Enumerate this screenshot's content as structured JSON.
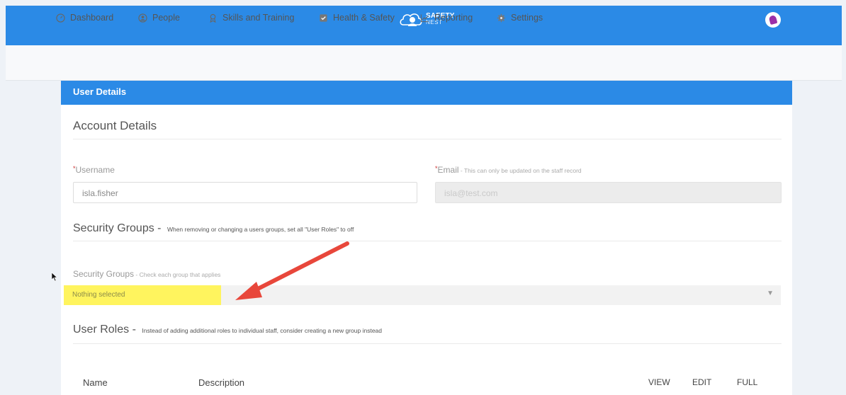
{
  "header": {
    "logo_line1": "SAFETY",
    "logo_line2": "NEST",
    "avatar": "user-avatar"
  },
  "nav": {
    "items": [
      {
        "label": "Dashboard",
        "icon": "dashboard-icon"
      },
      {
        "label": "People",
        "icon": "user-icon"
      },
      {
        "label": "Skills and Training",
        "icon": "award-icon"
      },
      {
        "label": "Health & Safety",
        "icon": "clipboard-check-icon"
      },
      {
        "label": "Reporting",
        "icon": "chart-line-icon"
      },
      {
        "label": "Settings",
        "icon": "gear-icon"
      }
    ]
  },
  "panel": {
    "title": "User Details",
    "account_heading": "Account Details",
    "username": {
      "required_mark": "*",
      "label": "Username",
      "value": "isla.fisher"
    },
    "email": {
      "required_mark": "*",
      "label": "Email",
      "note": " - This can only be updated on the staff record",
      "value": "isla@test.com"
    },
    "security_groups": {
      "heading": "Security Groups",
      "dash": " - ",
      "note": "When removing or changing a users groups, set all \"User Roles\" to off",
      "field_label": "Security Groups",
      "field_note": " - Check each group that applies",
      "select_value": "Nothing selected",
      "highlight_color": "#fff45e"
    },
    "user_roles": {
      "heading": "User Roles",
      "dash": " - ",
      "note": "Instead of adding additional roles to individual staff, consider creating a new group instead",
      "columns": [
        "Name",
        "Description",
        "VIEW",
        "EDIT",
        "FULL"
      ]
    }
  },
  "colors": {
    "brand_blue": "#2b8ae6",
    "annotation_arrow": "#e8473b"
  }
}
